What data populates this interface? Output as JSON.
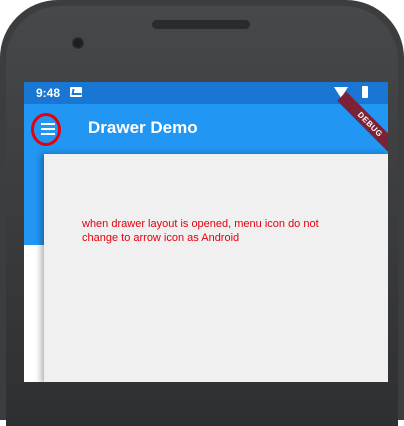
{
  "status_bar": {
    "time": "9:48"
  },
  "app_bar": {
    "title": "Drawer Demo"
  },
  "debug_banner": {
    "label": "DEBUG"
  },
  "annotation": {
    "text": "when drawer layout is opened, menu icon do not change to arrow icon as Android"
  },
  "colors": {
    "status_bar": "#1976d2",
    "app_bar": "#2196f3",
    "drawer_background": "#f0f0f0",
    "annotation": "#e3000f",
    "phone_frame": "#3c3d3f"
  },
  "icons": [
    "menu-icon",
    "message-icon",
    "wifi-icon",
    "battery-icon"
  ]
}
